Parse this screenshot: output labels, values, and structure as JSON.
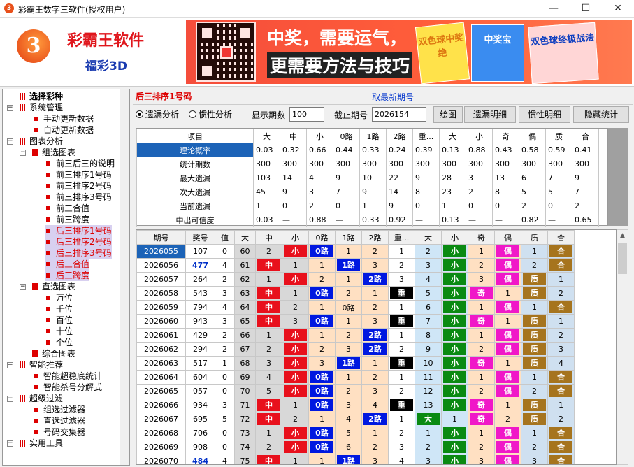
{
  "window": {
    "title": "彩霸王数字三软件(授权用户)",
    "app_icon": "3"
  },
  "banner": {
    "brand": "彩霸王软件",
    "product": "福彩3D",
    "logo_char": "3",
    "slogan1": "中奖，需要运气，",
    "slogan2": "更需要方法与技巧",
    "books": [
      "双色球中奖绝",
      "中奖宝",
      "双色球终极战法"
    ]
  },
  "tree": [
    {
      "label": "选择彩种",
      "level": 0,
      "bold": true,
      "leaf": false,
      "expander": ""
    },
    {
      "label": "系统管理",
      "level": 0,
      "leaf": false,
      "expander": "-"
    },
    {
      "label": "手动更新数据",
      "level": 1,
      "leaf": true
    },
    {
      "label": "自动更新数据",
      "level": 1,
      "leaf": true
    },
    {
      "label": "图表分析",
      "level": 0,
      "leaf": false,
      "expander": "-"
    },
    {
      "label": "组选图表",
      "level": 1,
      "leaf": false,
      "expander": "-"
    },
    {
      "label": "前三后三的说明",
      "level": 2,
      "leaf": true
    },
    {
      "label": "前三排序1号码",
      "level": 2,
      "leaf": true
    },
    {
      "label": "前三排序2号码",
      "level": 2,
      "leaf": true
    },
    {
      "label": "前三排序3号码",
      "level": 2,
      "leaf": true
    },
    {
      "label": "前三合值",
      "level": 2,
      "leaf": true
    },
    {
      "label": "前三跨度",
      "level": 2,
      "leaf": true
    },
    {
      "label": "后三排序1号码",
      "level": 2,
      "leaf": true,
      "selected": true
    },
    {
      "label": "后三排序2号码",
      "level": 2,
      "leaf": true,
      "selected": true
    },
    {
      "label": "后三排序3号码",
      "level": 2,
      "leaf": true,
      "selected": true
    },
    {
      "label": "后三合值",
      "level": 2,
      "leaf": true,
      "selected": true
    },
    {
      "label": "后三跨度",
      "level": 2,
      "leaf": true,
      "selected": true
    },
    {
      "label": "直选图表",
      "level": 1,
      "leaf": false,
      "expander": "-"
    },
    {
      "label": "万位",
      "level": 2,
      "leaf": true
    },
    {
      "label": "千位",
      "level": 2,
      "leaf": true
    },
    {
      "label": "百位",
      "level": 2,
      "leaf": true
    },
    {
      "label": "十位",
      "level": 2,
      "leaf": true
    },
    {
      "label": "个位",
      "level": 2,
      "leaf": true
    },
    {
      "label": "综合图表",
      "level": 1,
      "leaf": false,
      "expander": ""
    },
    {
      "label": "智能推荐",
      "level": 0,
      "leaf": false,
      "expander": "-"
    },
    {
      "label": "智能超稳底统计",
      "level": 1,
      "leaf": true
    },
    {
      "label": "智能杀号分解式",
      "level": 1,
      "leaf": true
    },
    {
      "label": "超级过滤",
      "level": 0,
      "leaf": false,
      "expander": "-"
    },
    {
      "label": "组选过滤器",
      "level": 1,
      "leaf": true
    },
    {
      "label": "直选过滤器",
      "level": 1,
      "leaf": true
    },
    {
      "label": "号码交集器",
      "level": 1,
      "leaf": true
    },
    {
      "label": "实用工具",
      "level": 0,
      "leaf": false,
      "expander": "-"
    }
  ],
  "panel": {
    "title": "后三排序1号码",
    "new_issue_link": "取最新期号"
  },
  "controls": {
    "radio_missing": "遗漏分析",
    "radio_inertia": "惯性分析",
    "show_count_label": "显示期数",
    "show_count_value": "100",
    "end_issue_label": "截止期号",
    "end_issue_value": "2026154",
    "btn_draw": "绘图",
    "btn_missing_detail": "遗漏明细",
    "btn_inertia_detail": "惯性明细",
    "btn_hide_stats": "隐藏统计"
  },
  "stats": {
    "headers": [
      "项目",
      "大",
      "中",
      "小",
      "0路",
      "1路",
      "2路",
      "重...",
      "大",
      "小",
      "奇",
      "偶",
      "质",
      "合"
    ],
    "rows": [
      [
        "理论概率",
        "0.03",
        "0.32",
        "0.66",
        "0.44",
        "0.33",
        "0.24",
        "0.39",
        "0.13",
        "0.88",
        "0.43",
        "0.58",
        "0.59",
        "0.41"
      ],
      [
        "统计期数",
        "300",
        "300",
        "300",
        "300",
        "300",
        "300",
        "300",
        "300",
        "300",
        "300",
        "300",
        "300",
        "300"
      ],
      [
        "最大遗漏",
        "103",
        "14",
        "4",
        "9",
        "10",
        "22",
        "9",
        "28",
        "3",
        "13",
        "6",
        "7",
        "9"
      ],
      [
        "次大遗漏",
        "45",
        "9",
        "3",
        "7",
        "9",
        "14",
        "8",
        "23",
        "2",
        "8",
        "5",
        "5",
        "7"
      ],
      [
        "当前遗漏",
        "1",
        "0",
        "2",
        "0",
        "1",
        "9",
        "0",
        "1",
        "0",
        "0",
        "2",
        "0",
        "2"
      ],
      [
        "中出可信度",
        "0.03",
        "—",
        "0.88",
        "—",
        "0.33",
        "0.92",
        "—",
        "0.13",
        "—",
        "—",
        "0.82",
        "—",
        "0.65"
      ]
    ]
  },
  "grid": {
    "headers": [
      "期号",
      "奖号",
      "值",
      "大",
      "中",
      "小",
      "0路",
      "1路",
      "2路",
      "重...",
      "大",
      "小",
      "奇",
      "偶",
      "质",
      "合"
    ],
    "rows": [
      [
        "2026055",
        "107",
        "0",
        "60",
        "2",
        "小",
        "0路",
        "1",
        "2",
        "1",
        "2",
        "小",
        "1",
        "偶",
        "1",
        "合"
      ],
      [
        "2026056",
        "477",
        "4",
        "61",
        "中",
        "1",
        "1",
        "1路",
        "3",
        "2",
        "3",
        "小",
        "2",
        "偶",
        "2",
        "合"
      ],
      [
        "2026057",
        "264",
        "2",
        "62",
        "1",
        "小",
        "2",
        "1",
        "2路",
        "3",
        "4",
        "小",
        "3",
        "偶",
        "质",
        "1"
      ],
      [
        "2026058",
        "543",
        "3",
        "63",
        "中",
        "1",
        "0路",
        "2",
        "1",
        "重",
        "5",
        "小",
        "奇",
        "1",
        "质",
        "2"
      ],
      [
        "2026059",
        "794",
        "4",
        "64",
        "中",
        "2",
        "1",
        "0路",
        "2",
        "1",
        "6",
        "小",
        "1",
        "偶",
        "1",
        "合"
      ],
      [
        "2026060",
        "943",
        "3",
        "65",
        "中",
        "3",
        "0路",
        "1",
        "3",
        "重",
        "7",
        "小",
        "奇",
        "1",
        "质",
        "1"
      ],
      [
        "2026061",
        "429",
        "2",
        "66",
        "1",
        "小",
        "1",
        "2",
        "2路",
        "1",
        "8",
        "小",
        "1",
        "偶",
        "质",
        "2"
      ],
      [
        "2026062",
        "294",
        "2",
        "67",
        "2",
        "小",
        "2",
        "3",
        "2路",
        "2",
        "9",
        "小",
        "2",
        "偶",
        "质",
        "3"
      ],
      [
        "2026063",
        "517",
        "1",
        "68",
        "3",
        "小",
        "3",
        "1路",
        "1",
        "重",
        "10",
        "小",
        "奇",
        "1",
        "质",
        "4"
      ],
      [
        "2026064",
        "604",
        "0",
        "69",
        "4",
        "小",
        "0路",
        "1",
        "2",
        "1",
        "11",
        "小",
        "1",
        "偶",
        "1",
        "合"
      ],
      [
        "2026065",
        "057",
        "0",
        "70",
        "5",
        "小",
        "0路",
        "2",
        "3",
        "2",
        "12",
        "小",
        "2",
        "偶",
        "2",
        "合"
      ],
      [
        "2026066",
        "934",
        "3",
        "71",
        "中",
        "1",
        "0路",
        "3",
        "4",
        "重",
        "13",
        "小",
        "奇",
        "1",
        "质",
        "1"
      ],
      [
        "2026067",
        "695",
        "5",
        "72",
        "中",
        "2",
        "1",
        "4",
        "2路",
        "1",
        "大",
        "1",
        "奇",
        "2",
        "质",
        "2"
      ],
      [
        "2026068",
        "706",
        "0",
        "73",
        "1",
        "小",
        "0路",
        "5",
        "1",
        "2",
        "1",
        "小",
        "1",
        "偶",
        "1",
        "合"
      ],
      [
        "2026069",
        "908",
        "0",
        "74",
        "2",
        "小",
        "0路",
        "6",
        "2",
        "3",
        "2",
        "小",
        "2",
        "偶",
        "2",
        "合"
      ],
      [
        "2026070",
        "484",
        "4",
        "75",
        "中",
        "1",
        "1",
        "1路",
        "3",
        "4",
        "3",
        "小",
        "3",
        "偶",
        "3",
        "合"
      ]
    ],
    "emph_nums": [
      "477",
      "484"
    ]
  },
  "colors": {
    "da": "#e8101c",
    "xiao": "#e8101c",
    "r0": "#0018e0",
    "r1": "#0018e0",
    "r2": "#0018e0",
    "chong": "#000000",
    "xiao2": "#0a8a12",
    "ji": "#f018c8",
    "ou": "#f018c8",
    "zhi": "#a6741e",
    "he": "#a6741e"
  }
}
